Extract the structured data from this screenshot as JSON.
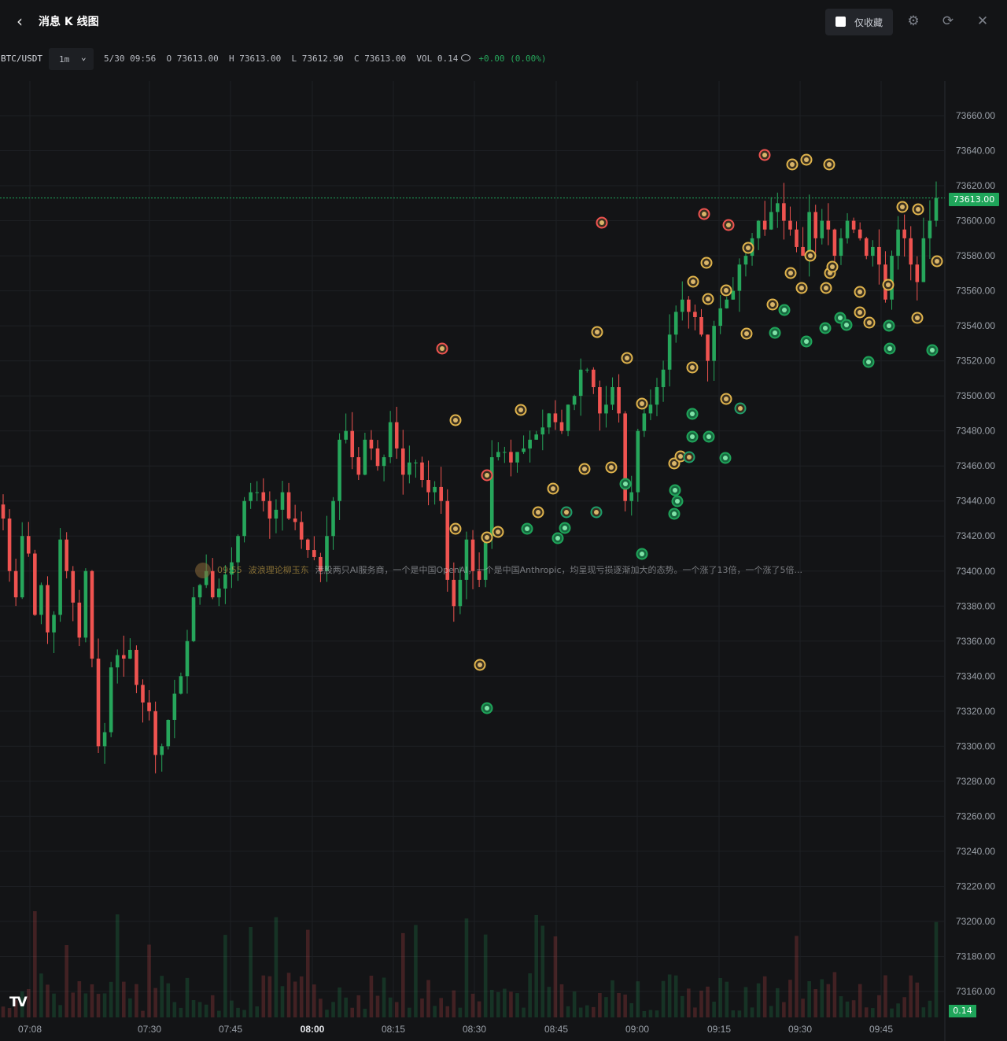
{
  "header": {
    "title": "消息 K 线图",
    "fav_label": "仅收藏"
  },
  "info": {
    "symbol": "BTC/USDT",
    "interval": "1m",
    "datetime": "5/30 09:56",
    "o_label": "O",
    "o": "73613.00",
    "h_label": "H",
    "h": "73613.00",
    "l_label": "L",
    "l": "73612.90",
    "c_label": "C",
    "c": "73613.00",
    "vol_label": "VOL",
    "vol": "0.14",
    "change": "+0.00 (0.00%)"
  },
  "news": {
    "time": "09:55",
    "author": "波浪理论柳玉东",
    "text": "港股两只AI服务商，一个是中国OpenAI，一个是中国Anthropic，均呈现亏损逐渐加大的态势。一个涨了13倍，一个涨了5倍..."
  },
  "price_label": "73613.00",
  "volume_label": "0.14",
  "colors": {
    "up": "#26a65b",
    "down": "#ef5350",
    "background": "#131416",
    "news_gold": "#e0b44c"
  },
  "chart_data": {
    "type": "candlestick",
    "yticks": [
      "73660.00",
      "73640.00",
      "73620.00",
      "73600.00",
      "73580.00",
      "73560.00",
      "73540.00",
      "73520.00",
      "73500.00",
      "73480.00",
      "73460.00",
      "73440.00",
      "73420.00",
      "73400.00",
      "73380.00",
      "73360.00",
      "73340.00",
      "73320.00",
      "73300.00",
      "73280.00",
      "73260.00",
      "73240.00",
      "73220.00",
      "73200.00",
      "73180.00",
      "73160.00"
    ],
    "xticks": [
      "07:08",
      "07:30",
      "07:45",
      "08:00",
      "08:15",
      "08:30",
      "08:45",
      "09:00",
      "09:15",
      "09:30",
      "09:45"
    ],
    "last_price": 73613.0,
    "closes": [
      73430,
      73400,
      73385,
      73420,
      73410,
      73375,
      73392,
      73365,
      73375,
      73418,
      73400,
      73382,
      73362,
      73400,
      73350,
      73300,
      73308,
      73345,
      73352,
      73350,
      73355,
      73335,
      73325,
      73320,
      73295,
      73300,
      73315,
      73330,
      73340,
      73360,
      73385,
      73392,
      73400,
      73385,
      73390,
      73398,
      73405,
      73420,
      73440,
      73445,
      73445,
      73440,
      73430,
      73435,
      73445,
      73430,
      73428,
      73418,
      73412,
      73408,
      73400,
      73420,
      73440,
      73475,
      73480,
      73465,
      73455,
      73475,
      73470,
      73460,
      73465,
      73485,
      73470,
      73455,
      73462,
      73462,
      73452,
      73445,
      73448,
      73440,
      73395,
      73380,
      73395,
      73418,
      73400,
      73395,
      73420,
      73465,
      73468,
      73468,
      73462,
      73468,
      73470,
      73475,
      73478,
      73482,
      73490,
      73485,
      73480,
      73495,
      73500,
      73515,
      73515,
      73505,
      73490,
      73495,
      73505,
      73490,
      73440,
      73445,
      73480,
      73490,
      73495,
      73505,
      73515,
      73535,
      73548,
      73555,
      73548,
      73545,
      73535,
      73520,
      73540,
      73550,
      73555,
      73560,
      73575,
      73580,
      73590,
      73600,
      73595,
      73605,
      73610,
      73600,
      73595,
      73585,
      73580,
      73605,
      73590,
      73600,
      73595,
      73580,
      73590,
      73600,
      73595,
      73590,
      73580,
      73585,
      73575,
      73555,
      73580,
      73595,
      73590,
      73575,
      73565,
      73590,
      73600,
      73613
    ],
    "price_range": [
      73150,
      73680
    ]
  }
}
